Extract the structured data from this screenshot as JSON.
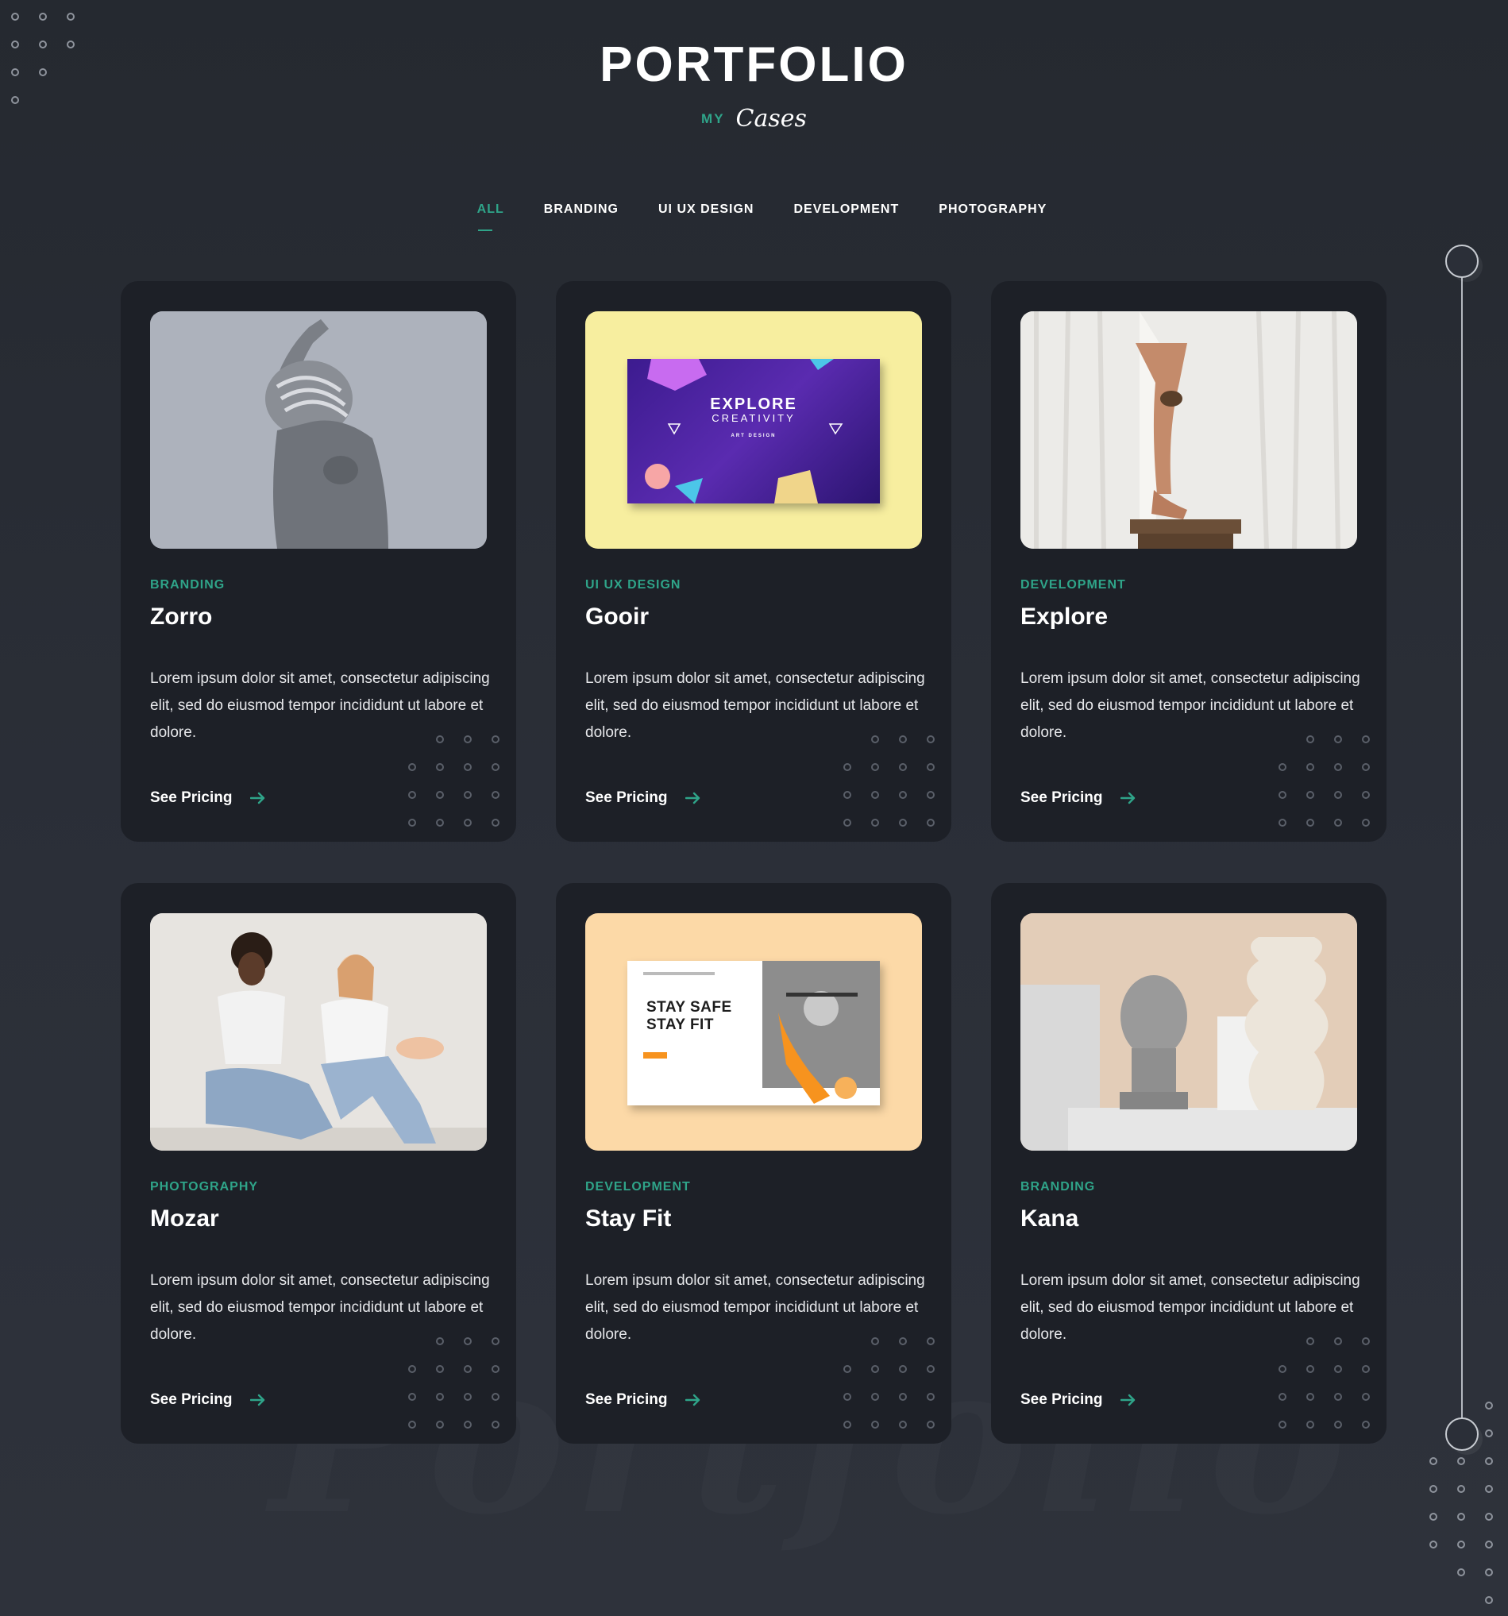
{
  "header": {
    "title": "PORTFOLIO",
    "subtitle_small": "MY",
    "subtitle_script": "Cases"
  },
  "watermark": "Portfolio",
  "tabs": [
    {
      "label": "ALL",
      "active": true
    },
    {
      "label": "BRANDING",
      "active": false
    },
    {
      "label": "UI UX DESIGN",
      "active": false
    },
    {
      "label": "DEVELOPMENT",
      "active": false
    },
    {
      "label": "PHOTOGRAPHY",
      "active": false
    }
  ],
  "colors": {
    "accent": "#2fa489",
    "background": "#2a2e37",
    "card": "#1d2027"
  },
  "cards": [
    {
      "category": "BRANDING",
      "title": "Zorro",
      "description": "Lorem ipsum dolor sit amet, consectetur adipiscing elit, sed do eiusmod tempor incididunt ut labore et dolore.",
      "link": "See Pricing",
      "image_alt": "Monochrome photo of a dancer with a raised arm"
    },
    {
      "category": "UI UX DESIGN",
      "title": "Gooir",
      "description": "Lorem ipsum dolor sit amet, consectetur adipiscing elit, sed do eiusmod tempor incididunt ut labore et dolore.",
      "link": "See Pricing",
      "image_heading": "EXPLORE",
      "image_subheading": "CREATIVITY",
      "image_small": "ART DESIGN"
    },
    {
      "category": "DEVELOPMENT",
      "title": "Explore",
      "description": "Lorem ipsum dolor sit amet, consectetur adipiscing elit, sed do eiusmod tempor incididunt ut labore et dolore.",
      "link": "See Pricing",
      "image_alt": "Leg on a wooden stool in front of white curtains"
    },
    {
      "category": "PHOTOGRAPHY",
      "title": "Mozar",
      "description": "Lorem ipsum dolor sit amet, consectetur adipiscing elit, sed do eiusmod tempor incididunt ut labore et dolore.",
      "link": "See Pricing",
      "image_alt": "Two women sitting on the floor against a wall"
    },
    {
      "category": "DEVELOPMENT",
      "title": "Stay Fit",
      "description": "Lorem ipsum dolor sit amet, consectetur adipiscing elit, sed do eiusmod tempor incididunt ut labore et dolore.",
      "link": "See Pricing",
      "image_line1": "STAY SAFE",
      "image_line2": "STAY FIT"
    },
    {
      "category": "BRANDING",
      "title": "Kana",
      "description": "Lorem ipsum dolor sit amet, consectetur adipiscing elit, sed do eiusmod tempor incididunt ut labore et dolore.",
      "link": "See Pricing",
      "image_alt": "Stone buddha head and ceramic vase still life"
    }
  ]
}
